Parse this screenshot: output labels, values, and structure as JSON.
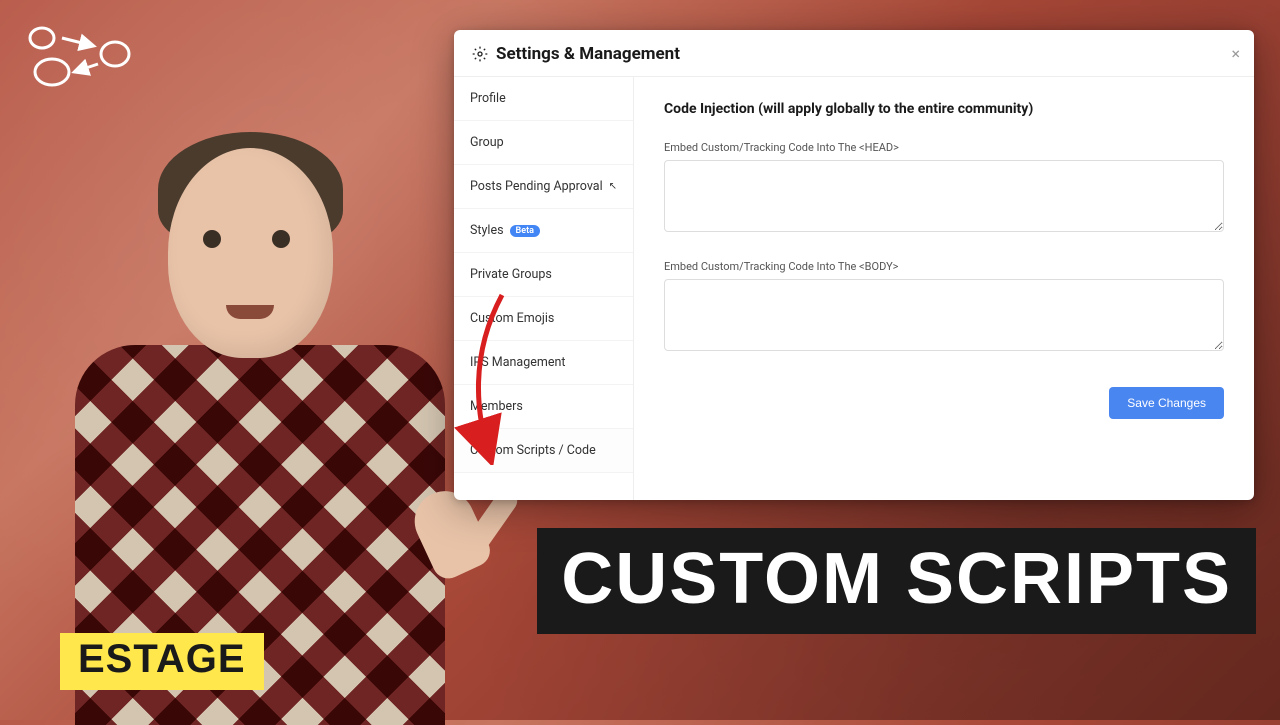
{
  "panel": {
    "title": "Settings & Management",
    "close": "×"
  },
  "sidebar": {
    "items": [
      {
        "label": "Profile"
      },
      {
        "label": "Group"
      },
      {
        "label": "Posts Pending Approval",
        "cursor": true
      },
      {
        "label": "Styles",
        "badge": "Beta"
      },
      {
        "label": "Private Groups"
      },
      {
        "label": "Custom Emojis"
      },
      {
        "label": "IPS Management"
      },
      {
        "label": "Members"
      },
      {
        "label": "Custom Scripts / Code",
        "active": true
      }
    ]
  },
  "content": {
    "heading": "Code Injection (will apply globally to the entire community)",
    "head_label": "Embed Custom/Tracking Code Into The <HEAD>",
    "body_label": "Embed Custom/Tracking Code Into The <BODY>",
    "head_value": "",
    "body_value": "",
    "save_label": "Save Changes"
  },
  "overlay": {
    "title": "CUSTOM SCRIPTS",
    "brand": "ESTAGE"
  }
}
